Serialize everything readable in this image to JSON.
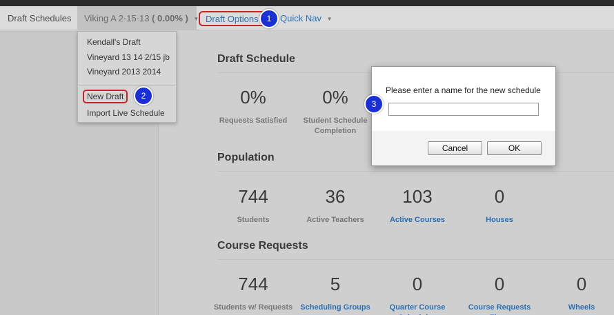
{
  "nav": {
    "brand": "Draft Schedules",
    "current_draft": "Viking A 2-15-13",
    "current_percent": "( 0.00% )",
    "draft_options": "Draft Options",
    "quick_nav": "Quick Nav"
  },
  "dropdown": {
    "items": [
      "Kendall's Draft",
      "Vineyard 13 14 2/15 jb",
      "Vineyard 2013 2014"
    ],
    "new_draft": "New Draft",
    "import_live": "Import Live Schedule"
  },
  "badges": [
    "1",
    "2",
    "3"
  ],
  "draft_schedule": {
    "title": "Draft Schedule",
    "stats": [
      {
        "value": "0%",
        "label": "Requests Satisfied"
      },
      {
        "value": "0%",
        "label": "Student Schedule Completion"
      }
    ]
  },
  "population": {
    "title": "Population",
    "stats": [
      {
        "value": "744",
        "label": "Students"
      },
      {
        "value": "36",
        "label": "Active Teachers"
      },
      {
        "value": "103",
        "label": "Active Courses"
      },
      {
        "value": "0",
        "label": "Houses"
      }
    ]
  },
  "course_requests": {
    "title": "Course Requests",
    "stats": [
      {
        "value": "744",
        "label": "Students w/ Requests"
      },
      {
        "value": "5",
        "label": "Scheduling Groups"
      },
      {
        "value": "0",
        "label": "Quarter Course Schedules"
      },
      {
        "value": "0",
        "label": "Course Requests Flags"
      },
      {
        "value": "0",
        "label": "Wheels"
      }
    ]
  },
  "dialog": {
    "message": "Please enter a name for the new schedule",
    "input_value": "",
    "cancel": "Cancel",
    "ok": "OK"
  },
  "colors": {
    "link": "#2a6fb3",
    "highlight": "#c8232b",
    "badge": "#1a2fd6"
  }
}
